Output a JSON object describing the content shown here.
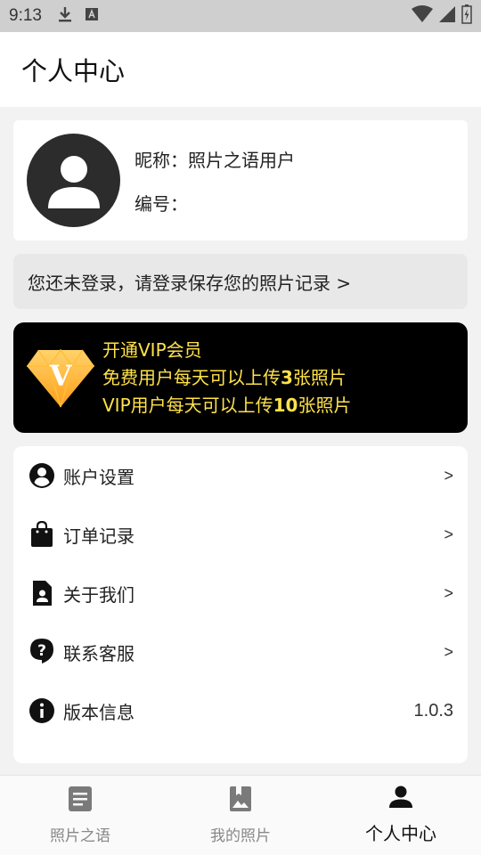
{
  "status_bar": {
    "time": "9:13"
  },
  "header": {
    "title": "个人中心"
  },
  "profile": {
    "nickname_label": "昵称：",
    "nickname_value": "照片之语用户",
    "number_label": "编号：",
    "number_value": ""
  },
  "login_banner": {
    "text": "您还未登录，请登录保存您的照片记录 >"
  },
  "vip": {
    "badge_letter": "V",
    "title": "开通VIP会员",
    "line1_prefix": "免费用户每天可以上传",
    "line1_count": "3",
    "line1_suffix": "张照片",
    "line2_prefix": "VIP用户每天可以上传",
    "line2_count": "10",
    "line2_suffix": "张照片",
    "text_color": "#ffe24a"
  },
  "menu": {
    "items": [
      {
        "label": "账户设置",
        "trail": ">",
        "icon": "account-circle-icon"
      },
      {
        "label": "订单记录",
        "trail": ">",
        "icon": "shopping-bag-icon"
      },
      {
        "label": "关于我们",
        "trail": ">",
        "icon": "contact-card-icon"
      },
      {
        "label": "联系客服",
        "trail": ">",
        "icon": "help-icon"
      },
      {
        "label": "版本信息",
        "trail": "1.0.3",
        "icon": "info-icon"
      }
    ]
  },
  "bottom_nav": {
    "tabs": [
      {
        "label": "照片之语",
        "icon": "document-icon",
        "active": false
      },
      {
        "label": "我的照片",
        "icon": "photo-album-icon",
        "active": false
      },
      {
        "label": "个人中心",
        "icon": "person-icon",
        "active": true
      }
    ]
  }
}
